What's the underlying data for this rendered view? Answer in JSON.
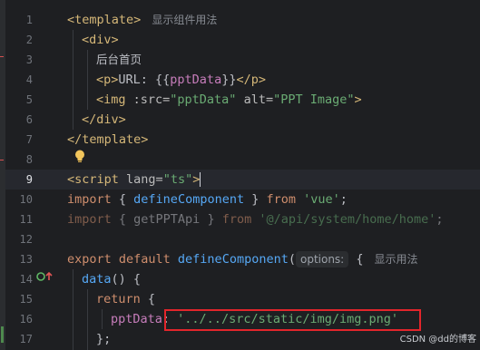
{
  "editor": {
    "line_numbers": [
      "1",
      "2",
      "3",
      "4",
      "5",
      "6",
      "7",
      "8",
      "9",
      "10",
      "11",
      "12",
      "13",
      "14",
      "15",
      "16",
      "17"
    ],
    "active_line": "9",
    "lines": {
      "l1": {
        "open": "<",
        "tag": "template",
        "close": ">",
        "hint": "显示组件用法"
      },
      "l2": {
        "tag": "<div>"
      },
      "l3": {
        "text": "后台首页"
      },
      "l4": {
        "p_open": "<p>",
        "text": "URL: {{",
        "prop": "pptData",
        "text2": "}}",
        "p_close": "</p>"
      },
      "l5": {
        "open": "<img ",
        "attr1": ":src=",
        "val1": "\"pptData\"",
        "attr2": " alt=",
        "val2": "\"PPT Image\"",
        "close": ">"
      },
      "l6": {
        "tag": "</div>"
      },
      "l7": {
        "tag": "</template>"
      },
      "l9": {
        "open": "<",
        "tag": "script",
        "attr": " lang=",
        "val": "\"ts\"",
        "close": ">"
      },
      "l10": {
        "kw1": "import",
        "p1": " { ",
        "fn": "defineComponent",
        "p2": " } ",
        "kw2": "from",
        "s": " 'vue'",
        "end": ";"
      },
      "l11": {
        "kw1": "import",
        "p1": " { getPPTApi } ",
        "kw2": "from",
        "s": " '@/api/system/home/home'",
        "end": ";"
      },
      "l13": {
        "kw1": "export default ",
        "fn": "defineComponent",
        "p": "(",
        "hint_box": "options:",
        "p2": " {",
        "hint": "显示用法"
      },
      "l14": {
        "fn": "data",
        "p": "() {"
      },
      "l15": {
        "kw": "return",
        "p": " {"
      },
      "l16": {
        "prop": "pptData",
        "colon": ": ",
        "s": "'../../src/static/img/img.png'"
      },
      "l17": {
        "text": "};"
      }
    }
  },
  "watermark": "CSDN @dd的博客",
  "icons": {
    "bulb": "lightbulb-icon",
    "gutter": "implementation-gutter-icon"
  },
  "colors": {
    "highlight_box": "#e2252b",
    "background": "#1e1f22"
  }
}
